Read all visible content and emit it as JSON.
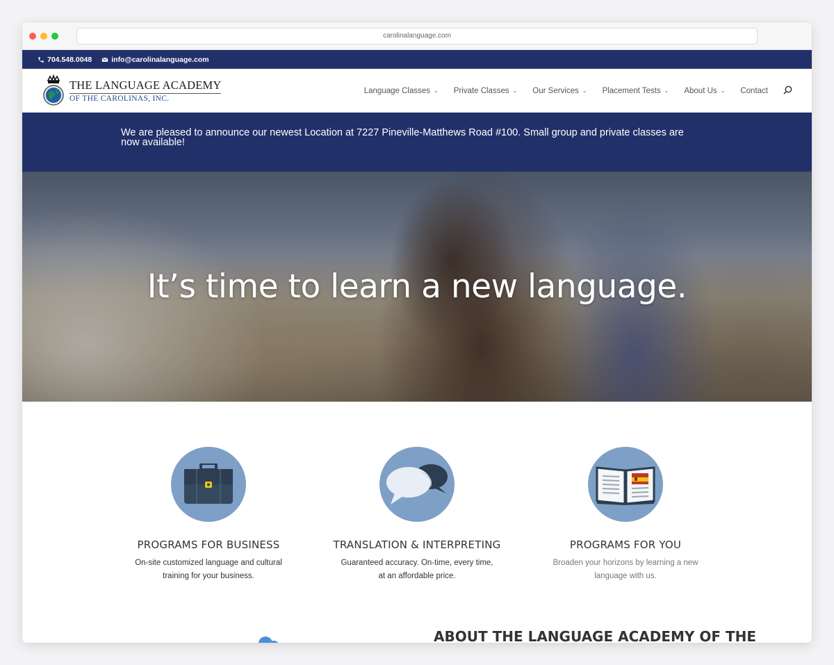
{
  "browser": {
    "url": "carolinalanguage.com"
  },
  "topbar": {
    "phone": "704.548.0048",
    "email": "info@carolinalanguage.com"
  },
  "logo": {
    "line1": "THE LANGUAGE ACADEMY",
    "line2": "OF THE CAROLINAS, INC."
  },
  "nav": {
    "items": [
      {
        "label": "Language Classes",
        "dropdown": true
      },
      {
        "label": "Private Classes",
        "dropdown": true
      },
      {
        "label": "Our Services",
        "dropdown": true
      },
      {
        "label": "Placement Tests",
        "dropdown": true
      },
      {
        "label": "About Us",
        "dropdown": true
      },
      {
        "label": "Contact",
        "dropdown": false
      }
    ],
    "search_icon": "search-icon"
  },
  "announcement": "We are pleased to announce our newest Location at 7227 Pineville-Matthews Road #100. Small group and private classes are now available!",
  "hero": {
    "headline": "It’s time to learn a new language."
  },
  "features": [
    {
      "icon": "briefcase-icon",
      "title": "PROGRAMS FOR BUSINESS",
      "text": "On-site customized language and cultural training for your business."
    },
    {
      "icon": "speech-bubbles-icon",
      "title": "TRANSLATION & INTERPRETING",
      "text": "Guaranteed accuracy. On-time, every time, at an affordable price."
    },
    {
      "icon": "open-book-icon",
      "title": "PROGRAMS FOR YOU",
      "text": "Broaden your horizons by learning a new language with us."
    }
  ],
  "about": {
    "title": "ABOUT THE LANGUAGE ACADEMY OF THE"
  },
  "colors": {
    "navy": "#22306a",
    "circle": "#7e9fc6",
    "hero_text": "#ffffff"
  }
}
